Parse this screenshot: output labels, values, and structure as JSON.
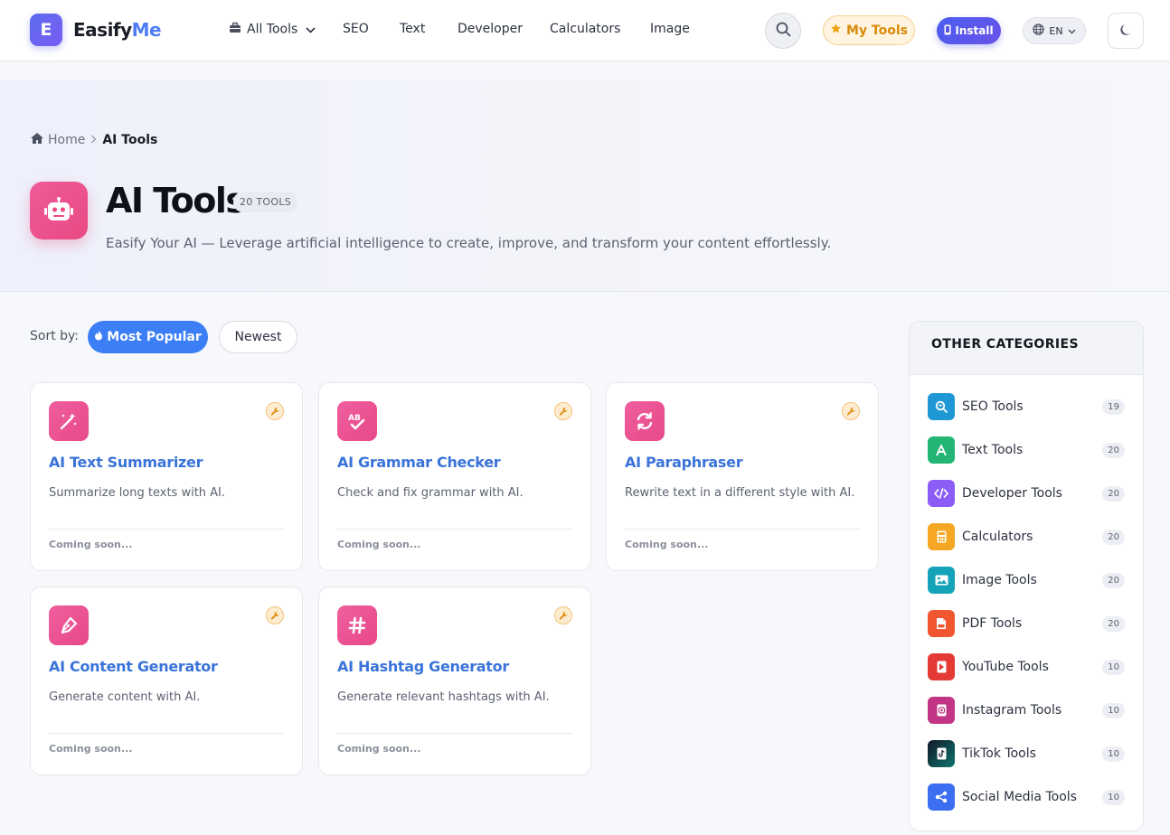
{
  "brand": {
    "logo_letter": "E",
    "name_part1": "Easify",
    "name_part2": "Me"
  },
  "nav": {
    "all_tools": "All Tools",
    "items": [
      "SEO",
      "Text",
      "Developer",
      "Calculators",
      "Image"
    ]
  },
  "header_actions": {
    "my_tools": "My Tools",
    "install": "Install",
    "language": "EN"
  },
  "breadcrumb": {
    "home": "Home",
    "current": "AI Tools"
  },
  "hero": {
    "title": "AI Tools",
    "badge": "20 TOOLS",
    "description": "Easify Your AI — Leverage artificial intelligence to create, improve, and transform your content effortlessly."
  },
  "sort": {
    "label": "Sort by:",
    "popular": "Most Popular",
    "newest": "Newest"
  },
  "tools": [
    {
      "title": "AI Text Summarizer",
      "description": "Summarize long texts with AI.",
      "status": "Coming soon...",
      "icon": "magic-wand-icon"
    },
    {
      "title": "AI Grammar Checker",
      "description": "Check and fix grammar with AI.",
      "status": "Coming soon...",
      "icon": "spell-check-icon"
    },
    {
      "title": "AI Paraphraser",
      "description": "Rewrite text in a different style with AI.",
      "status": "Coming soon...",
      "icon": "sync-icon"
    },
    {
      "title": "AI Content Generator",
      "description": "Generate content with AI.",
      "status": "Coming soon...",
      "icon": "pen-nib-icon"
    },
    {
      "title": "AI Hashtag Generator",
      "description": "Generate relevant hashtags with AI.",
      "status": "Coming soon...",
      "icon": "hashtag-icon"
    }
  ],
  "sidebar": {
    "heading": "OTHER CATEGORIES",
    "items": [
      {
        "label": "SEO Tools",
        "count": "19",
        "color": "#1f97d4",
        "icon": "seo-search-icon"
      },
      {
        "label": "Text Tools",
        "count": "20",
        "color": "#22b573",
        "icon": "text-icon"
      },
      {
        "label": "Developer Tools",
        "count": "20",
        "color": "#8b5cf6",
        "icon": "code-icon"
      },
      {
        "label": "Calculators",
        "count": "20",
        "color": "#f5a623",
        "icon": "calculator-icon"
      },
      {
        "label": "Image Tools",
        "count": "20",
        "color": "#14a3b8",
        "icon": "image-icon"
      },
      {
        "label": "PDF Tools",
        "count": "20",
        "color": "#f0562f",
        "icon": "pdf-icon"
      },
      {
        "label": "YouTube Tools",
        "count": "10",
        "color": "#e53935",
        "icon": "youtube-icon"
      },
      {
        "label": "Instagram Tools",
        "count": "10",
        "color": "#c13584",
        "icon": "instagram-icon"
      },
      {
        "label": "TikTok Tools",
        "count": "10",
        "color": "#111827",
        "icon": "tiktok-icon"
      },
      {
        "label": "Social Media Tools",
        "count": "10",
        "color": "#3b6ef0",
        "icon": "share-icon"
      }
    ]
  }
}
